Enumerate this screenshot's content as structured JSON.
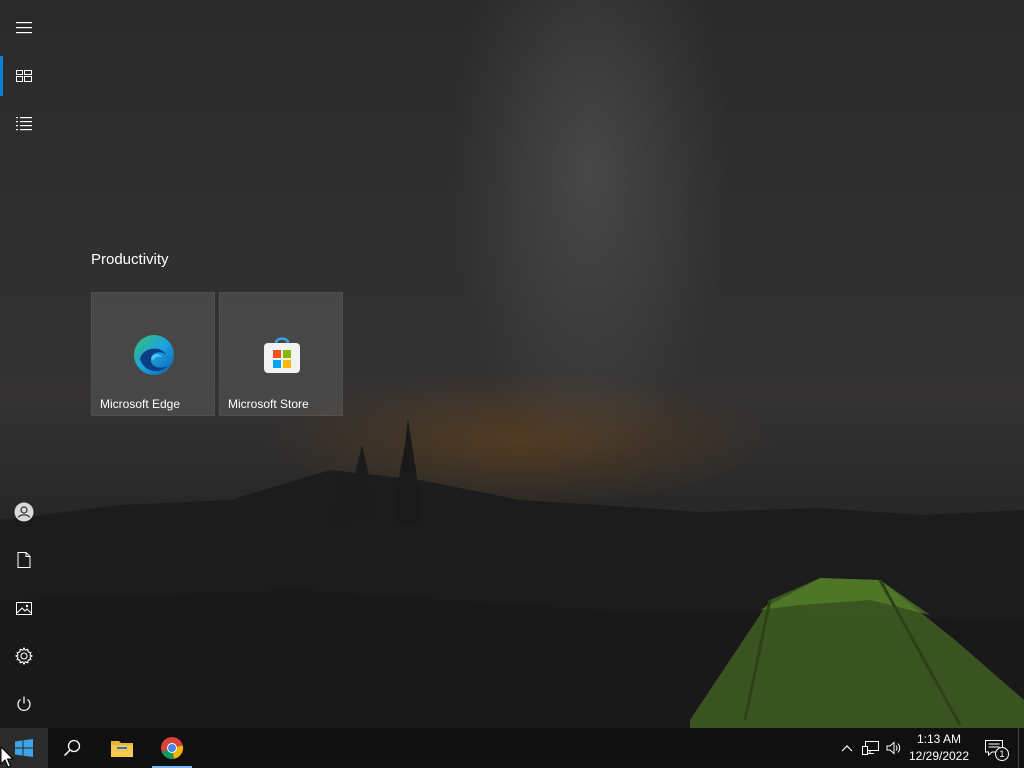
{
  "start_menu": {
    "rail": {
      "top_items": [
        {
          "name": "expand",
          "icon": "hamburger-icon"
        },
        {
          "name": "pinned-tiles",
          "icon": "tiles-icon",
          "active": true
        },
        {
          "name": "all-apps",
          "icon": "list-icon"
        }
      ],
      "bottom_items": [
        {
          "name": "account",
          "icon": "user-icon"
        },
        {
          "name": "documents",
          "icon": "document-icon"
        },
        {
          "name": "pictures",
          "icon": "pictures-icon"
        },
        {
          "name": "settings",
          "icon": "gear-icon"
        },
        {
          "name": "power",
          "icon": "power-icon"
        }
      ]
    },
    "group": {
      "title": "Productivity",
      "tiles": [
        {
          "label": "Microsoft Edge",
          "icon": "edge-icon"
        },
        {
          "label": "Microsoft Store",
          "icon": "store-icon"
        }
      ]
    }
  },
  "taskbar": {
    "start_icon": "windows-logo-icon",
    "search_icon": "search-icon",
    "pinned_apps": [
      {
        "name": "File Explorer",
        "icon": "folder-icon",
        "running": false
      },
      {
        "name": "Google Chrome",
        "icon": "chrome-icon",
        "running": true
      }
    ],
    "tray": {
      "chevron_icon": "chevron-up-icon",
      "network_icon": "network-icon",
      "volume_icon": "volume-icon",
      "time": "1:13 AM",
      "date": "12/29/2022",
      "notification_count": "1"
    }
  },
  "colors": {
    "accent": "#0a7fd6",
    "taskbar": "#101010",
    "running_indicator": "#76b9ed"
  }
}
